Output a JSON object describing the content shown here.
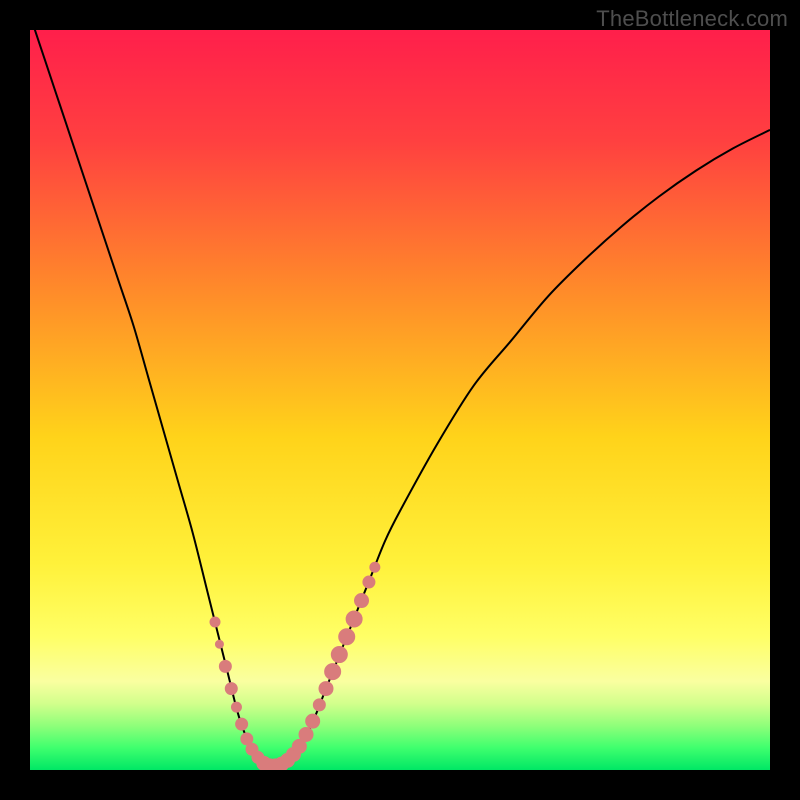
{
  "watermark": "TheBottleneck.com",
  "colors": {
    "frame": "#000000",
    "gradient_stops": [
      {
        "pos": 0.0,
        "color": "#ff1f4b"
      },
      {
        "pos": 0.15,
        "color": "#ff4040"
      },
      {
        "pos": 0.35,
        "color": "#ff8a2a"
      },
      {
        "pos": 0.55,
        "color": "#ffd31a"
      },
      {
        "pos": 0.72,
        "color": "#fff13a"
      },
      {
        "pos": 0.82,
        "color": "#ffff66"
      },
      {
        "pos": 0.88,
        "color": "#faffa0"
      },
      {
        "pos": 0.91,
        "color": "#d2ff8c"
      },
      {
        "pos": 0.94,
        "color": "#8fff7a"
      },
      {
        "pos": 0.97,
        "color": "#3fff6e"
      },
      {
        "pos": 1.0,
        "color": "#00e765"
      }
    ],
    "curve": "#000000",
    "marker_fill": "#d97c7c",
    "marker_stroke": "#d97c7c"
  },
  "chart_data": {
    "type": "line",
    "title": "",
    "xlabel": "",
    "ylabel": "",
    "xlim": [
      0,
      100
    ],
    "ylim": [
      0,
      100
    ],
    "series": [
      {
        "name": "bottleneck-curve",
        "x": [
          0,
          2,
          4,
          6,
          8,
          10,
          12,
          14,
          16,
          18,
          20,
          22,
          24,
          26,
          27,
          28,
          29,
          30,
          31,
          32,
          33,
          34,
          35,
          36,
          38,
          40,
          42,
          44,
          46,
          48,
          50,
          55,
          60,
          65,
          70,
          75,
          80,
          85,
          90,
          95,
          100
        ],
        "y": [
          102,
          96,
          90,
          84,
          78,
          72,
          66,
          60,
          53,
          46,
          39,
          32,
          24,
          16,
          12,
          8,
          5,
          3,
          1.5,
          0.8,
          0.5,
          0.7,
          1.2,
          2.3,
          6,
          11,
          16,
          21,
          26,
          31,
          35,
          44,
          52,
          58,
          64,
          69,
          73.5,
          77.5,
          81,
          84,
          86.5
        ]
      }
    ],
    "markers": [
      {
        "x": 25.0,
        "y": 20,
        "r": 5
      },
      {
        "x": 25.6,
        "y": 17,
        "r": 4
      },
      {
        "x": 26.4,
        "y": 14,
        "r": 6
      },
      {
        "x": 27.2,
        "y": 11,
        "r": 6
      },
      {
        "x": 27.9,
        "y": 8.5,
        "r": 5
      },
      {
        "x": 28.6,
        "y": 6.2,
        "r": 6
      },
      {
        "x": 29.3,
        "y": 4.2,
        "r": 6
      },
      {
        "x": 30.0,
        "y": 2.8,
        "r": 6
      },
      {
        "x": 30.8,
        "y": 1.7,
        "r": 6
      },
      {
        "x": 31.6,
        "y": 0.9,
        "r": 7
      },
      {
        "x": 32.4,
        "y": 0.55,
        "r": 7
      },
      {
        "x": 33.2,
        "y": 0.55,
        "r": 7
      },
      {
        "x": 34.0,
        "y": 0.8,
        "r": 7
      },
      {
        "x": 34.8,
        "y": 1.3,
        "r": 7
      },
      {
        "x": 35.6,
        "y": 2.1,
        "r": 7
      },
      {
        "x": 36.4,
        "y": 3.2,
        "r": 7
      },
      {
        "x": 37.3,
        "y": 4.8,
        "r": 7
      },
      {
        "x": 38.2,
        "y": 6.6,
        "r": 7
      },
      {
        "x": 39.1,
        "y": 8.8,
        "r": 6
      },
      {
        "x": 40.0,
        "y": 11.0,
        "r": 7
      },
      {
        "x": 40.9,
        "y": 13.3,
        "r": 8
      },
      {
        "x": 41.8,
        "y": 15.6,
        "r": 8
      },
      {
        "x": 42.8,
        "y": 18.0,
        "r": 8
      },
      {
        "x": 43.8,
        "y": 20.4,
        "r": 8
      },
      {
        "x": 44.8,
        "y": 22.9,
        "r": 7
      },
      {
        "x": 45.8,
        "y": 25.4,
        "r": 6
      },
      {
        "x": 46.6,
        "y": 27.4,
        "r": 5
      }
    ]
  }
}
